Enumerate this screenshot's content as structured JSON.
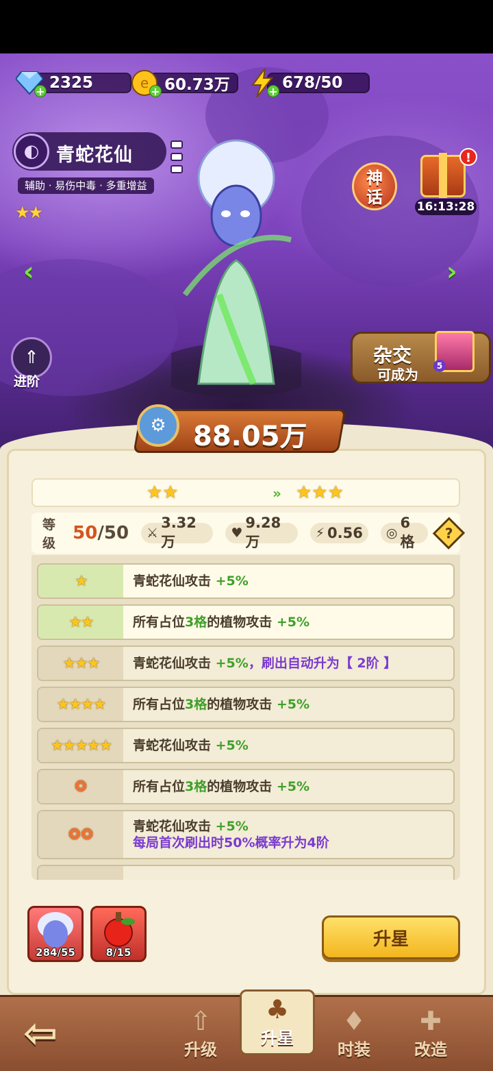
{
  "resources": {
    "gems": "2325",
    "coins": "60.73万",
    "energy": "678/50"
  },
  "hero": {
    "name": "青蛇花仙",
    "tags": "辅助 · 易伤中毒 · 多重增益",
    "stars": "★★",
    "rarity_badge": "神\n话",
    "gift_timer": "16:13:28",
    "gift_alert": "!"
  },
  "actions": {
    "advance_label": "进阶",
    "hybrid_line1": "杂交",
    "hybrid_line2": "可成为",
    "hybrid_level": "5"
  },
  "power": "88.05万",
  "star_upgrade": {
    "from": "★★",
    "to": "★★★"
  },
  "stats": {
    "level_label": "等级",
    "level": "50",
    "level_max": "/50",
    "attack": "3.32万",
    "hp": "9.28万",
    "speed": "0.56",
    "slots": "6格"
  },
  "star_bonuses": [
    {
      "cond": "★",
      "text_a": "青蛇花仙攻击",
      "text_b": " +5%",
      "unlocked": true
    },
    {
      "cond": "★★",
      "text_a": "所有占位",
      "text_b": "3格",
      "text_c": "的植物攻击",
      "text_d": " +5%",
      "unlocked": true
    },
    {
      "cond": "★★★",
      "text_a": "青蛇花仙攻击",
      "text_b": " +5%",
      "text_c": "，刷出自动升为【 2阶 】",
      "unlocked": false
    },
    {
      "cond": "★★★★",
      "text_a": "所有占位",
      "text_b": "3格",
      "text_c": "的植物攻击",
      "text_d": " +5%",
      "unlocked": false
    },
    {
      "cond": "★★★★★",
      "text_a": "青蛇花仙攻击",
      "text_b": " +5%",
      "unlocked": false
    },
    {
      "cond": "❂",
      "text_a": "所有占位",
      "text_b": "3格",
      "text_c": "的植物攻击",
      "text_d": " +5%",
      "unlocked": false
    },
    {
      "cond": "❂❂",
      "text_a": "青蛇花仙攻击",
      "text_b": " +5%",
      "text_c": "每局首次刷出时50%概率升为4阶",
      "unlocked": false
    }
  ],
  "materials": [
    {
      "name": "qingshe-shard",
      "count": "284/55"
    },
    {
      "name": "apple-item",
      "count": "8/15"
    }
  ],
  "upgrade_button": "升星",
  "nav": {
    "upgrade": "升级",
    "star": "升星",
    "outfit": "时装",
    "modify": "改造"
  }
}
